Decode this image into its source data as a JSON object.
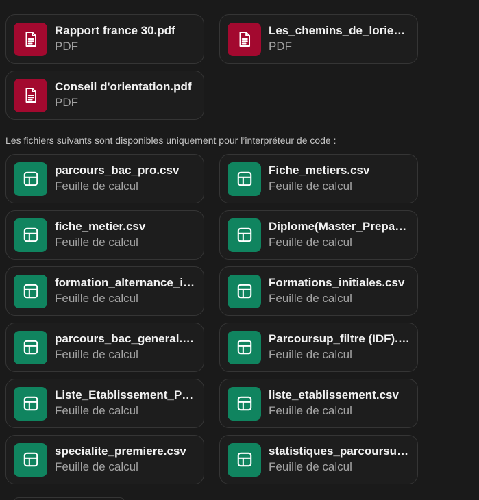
{
  "colors": {
    "pdf_tile": "#a3092f",
    "sheet_tile": "#10845f",
    "background": "#1a1a1a"
  },
  "pdf_files": [
    {
      "name": "Rapport france 30.pdf",
      "type": "PDF",
      "icon": "document-icon"
    },
    {
      "name": "Les_chemins_de_lorientati...",
      "type": "PDF",
      "icon": "document-icon"
    },
    {
      "name": "Conseil d'orientation.pdf",
      "type": "PDF",
      "icon": "document-icon"
    }
  ],
  "code_interpreter_note": "Les fichiers suivants sont disponibles uniquement pour l’interpréteur de code :",
  "sheet_files": [
    {
      "name": "parcours_bac_pro.csv",
      "type": "Feuille de calcul",
      "icon": "spreadsheet-icon"
    },
    {
      "name": "Fiche_metiers.csv",
      "type": "Feuille de calcul",
      "icon": "spreadsheet-icon"
    },
    {
      "name": "fiche_metier.csv",
      "type": "Feuille de calcul",
      "icon": "spreadsheet-icon"
    },
    {
      "name": "Diplome(Master_Prepa_Ec...",
      "type": "Feuille de calcul",
      "icon": "spreadsheet-icon"
    },
    {
      "name": "formation_alternance_idf....",
      "type": "Feuille de calcul",
      "icon": "spreadsheet-icon"
    },
    {
      "name": "Formations_initiales.csv",
      "type": "Feuille de calcul",
      "icon": "spreadsheet-icon"
    },
    {
      "name": "parcours_bac_general.csv",
      "type": "Feuille de calcul",
      "icon": "spreadsheet-icon"
    },
    {
      "name": "Parcoursup_filtre (IDF).csv",
      "type": "Feuille de calcul",
      "icon": "spreadsheet-icon"
    },
    {
      "name": "Liste_Etablissement_Parco...",
      "type": "Feuille de calcul",
      "icon": "spreadsheet-icon"
    },
    {
      "name": "liste_etablissement.csv",
      "type": "Feuille de calcul",
      "icon": "spreadsheet-icon"
    },
    {
      "name": "specialite_premiere.csv",
      "type": "Feuille de calcul",
      "icon": "spreadsheet-icon"
    },
    {
      "name": "statistiques_parcoursup.csv",
      "type": "Feuille de calcul",
      "icon": "spreadsheet-icon"
    }
  ]
}
